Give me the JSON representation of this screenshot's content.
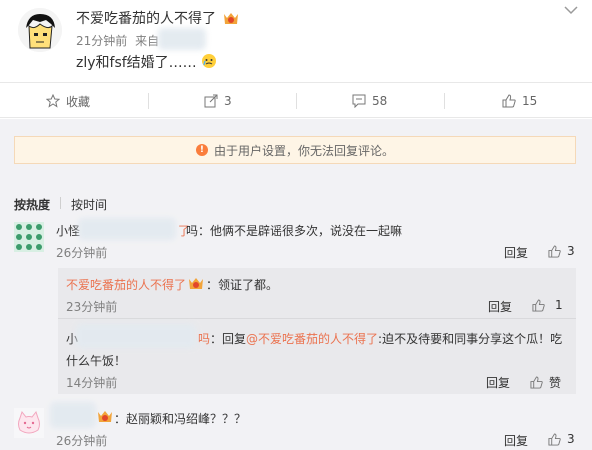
{
  "post": {
    "author": "不爱吃番茄的人不得了",
    "time": "21分钟前",
    "source_prefix": "来自",
    "text": "zly和fsf结婚了……"
  },
  "actions": {
    "collect": "收藏",
    "repost": "3",
    "comments": "58",
    "likes": "15"
  },
  "notice": "由于用户设置，你无法回复评论。",
  "sort": {
    "hot": "按热度",
    "time": "按时间"
  },
  "comments": [
    {
      "user": "小怪",
      "user_tail": "了",
      "text": "吗：他俩不是辟谣很多次，说没在一起嘛",
      "time": "26分钟前",
      "reply": "回复",
      "likes": "3"
    },
    {
      "user": "不爱吃番茄的人不得了",
      "text": "：领证了都。",
      "time": "23分钟前",
      "reply": "回复",
      "likes": "1"
    },
    {
      "user": "小",
      "user_tail": "吗",
      "reply_prefix": "：回复",
      "mention": "@不爱吃番茄的人不得了",
      "text_line1": ":迫不及待要和同事分享这个瓜！吃",
      "text_line2": "什么午饭！",
      "time": "14分钟前",
      "reply": "回复",
      "likes": "赞"
    },
    {
      "text": "：赵丽颖和冯绍峰？？？",
      "time": "26分钟前",
      "reply": "回复",
      "likes": "3"
    }
  ]
}
